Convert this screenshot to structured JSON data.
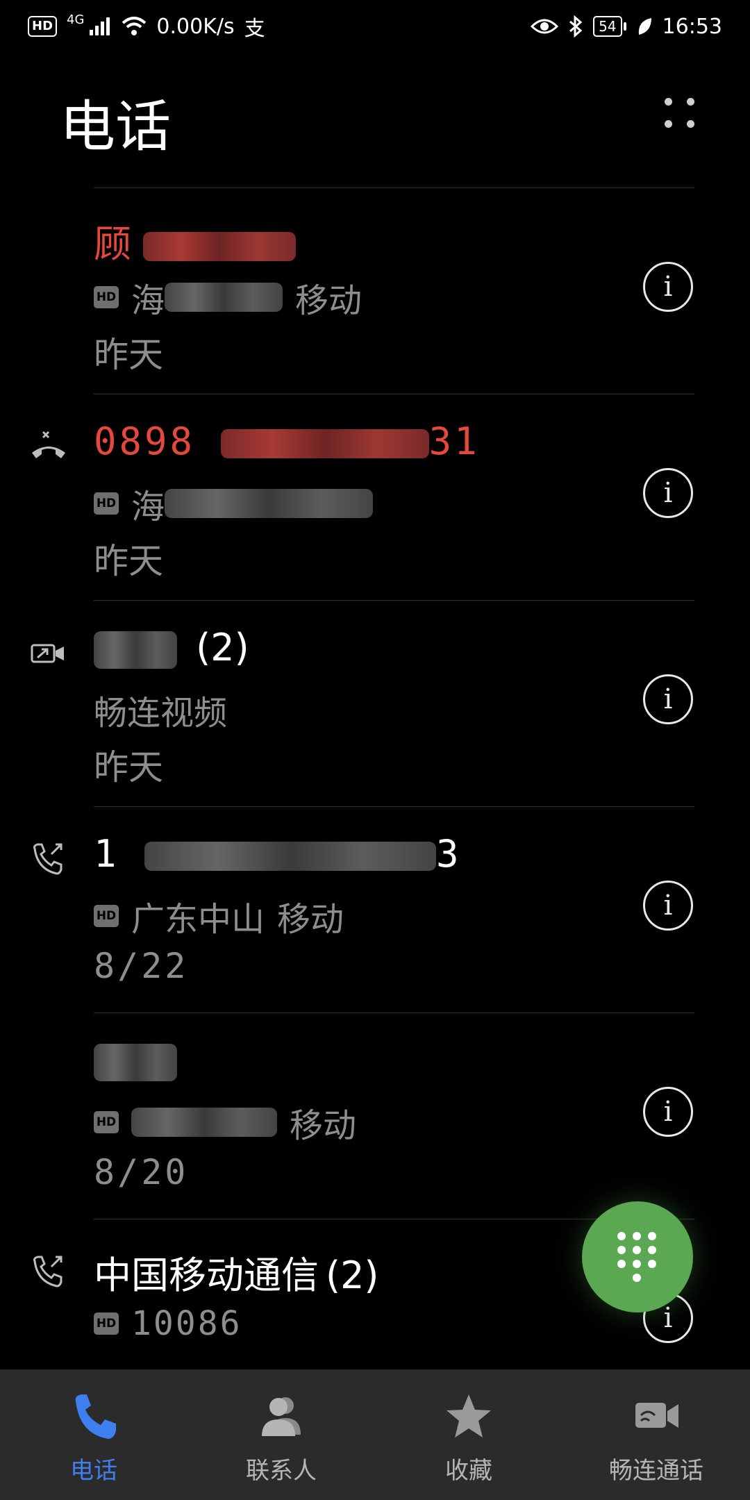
{
  "status_bar": {
    "left_badge": "HD",
    "network": "4G",
    "speed": "0.00K/s",
    "extra": "支",
    "battery": "54",
    "time": "16:53"
  },
  "header": {
    "title": "电话"
  },
  "calls": [
    {
      "type": "incoming",
      "name": "顾",
      "missed": true,
      "count": "",
      "location": "海",
      "carrier": "移动",
      "hd": "HD",
      "date": "昨天"
    },
    {
      "type": "missed",
      "name": "0898",
      "name_tail": "31",
      "missed": true,
      "count": "",
      "location": "海",
      "carrier": "",
      "hd": "HD",
      "date": "昨天"
    },
    {
      "type": "video",
      "name": "",
      "missed": false,
      "count": "(2)",
      "location": "畅连视频",
      "carrier": "",
      "hd": "",
      "date": "昨天"
    },
    {
      "type": "outgoing",
      "name": "1",
      "name_tail": "3",
      "missed": false,
      "count": "",
      "location": "广东中山",
      "carrier": "移动",
      "hd": "HD",
      "date": "8/22"
    },
    {
      "type": "incoming",
      "name": "",
      "missed": false,
      "count": "",
      "location": "",
      "carrier": "移动",
      "hd": "HD",
      "date": "8/20"
    },
    {
      "type": "outgoing",
      "name": "中国移动通信",
      "missed": false,
      "count": "(2)",
      "location": "10086",
      "carrier": "",
      "hd": "HD",
      "date": ""
    }
  ],
  "info_icon_glyph": "i",
  "bottom_nav": [
    {
      "label": "电话",
      "icon": "phone-icon",
      "active": true
    },
    {
      "label": "联系人",
      "icon": "contacts-icon",
      "active": false
    },
    {
      "label": "收藏",
      "icon": "star-icon",
      "active": false
    },
    {
      "label": "畅连通话",
      "icon": "video-call-icon",
      "active": false
    }
  ],
  "colors": {
    "accent": "#3e7ff0",
    "missed": "#e6483d",
    "fab": "#5aa952",
    "nav_bg": "#2b2b2b"
  }
}
